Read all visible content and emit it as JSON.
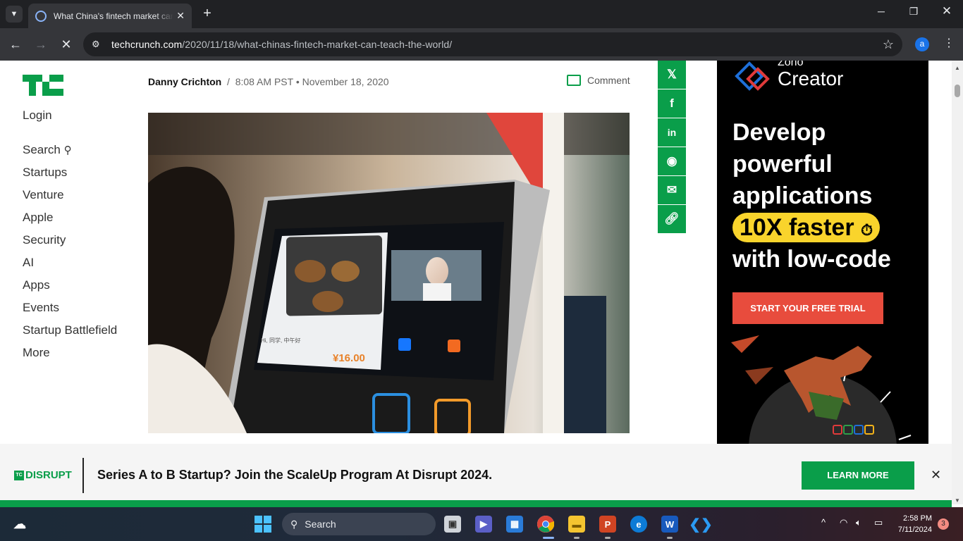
{
  "browser": {
    "tab_title": "What China's fintech market can teach the world",
    "url_host": "techcrunch.com",
    "url_path": "/2020/11/18/what-chinas-fintech-market-can-teach-the-world/",
    "profile_initial": "a"
  },
  "site": {
    "logo_text": "TC",
    "login": "Login",
    "nav": [
      "Search",
      "Startups",
      "Venture",
      "Apple",
      "Security",
      "AI",
      "Apps",
      "Events",
      "Startup Battlefield",
      "More"
    ]
  },
  "article": {
    "author": "Danny Crichton",
    "separator": "/",
    "time": "8:08 AM PST",
    "bullet": "•",
    "date": "November 18, 2020",
    "comment_label": "Comment",
    "hero_price": "¥16.00",
    "hero_greeting": "Hi, 同学, 中午好"
  },
  "share": [
    "x-icon",
    "facebook-icon",
    "linkedin-icon",
    "reddit-icon",
    "email-icon",
    "link-icon"
  ],
  "ad": {
    "brand_small": "Zoho",
    "brand_large": "Creator",
    "line1": "Develop",
    "line2": "powerful",
    "line3": "applications",
    "highlight": "10X faster",
    "line5": "with low-code",
    "cta": "START YOUR FREE TRIAL"
  },
  "banner": {
    "logo": "DISRUPT",
    "logo_badge": "TC",
    "message": "Series A to B Startup? Join the ScaleUp Program At Disrupt 2024.",
    "button": "LEARN MORE",
    "close": "✕"
  },
  "taskbar": {
    "search": "Search",
    "time": "2:58 PM",
    "date": "7/11/2024",
    "notifications": "3"
  },
  "colors": {
    "tc_green": "#0a9e4a",
    "ad_red": "#e84c3d",
    "ad_yellow": "#f9d42c"
  }
}
